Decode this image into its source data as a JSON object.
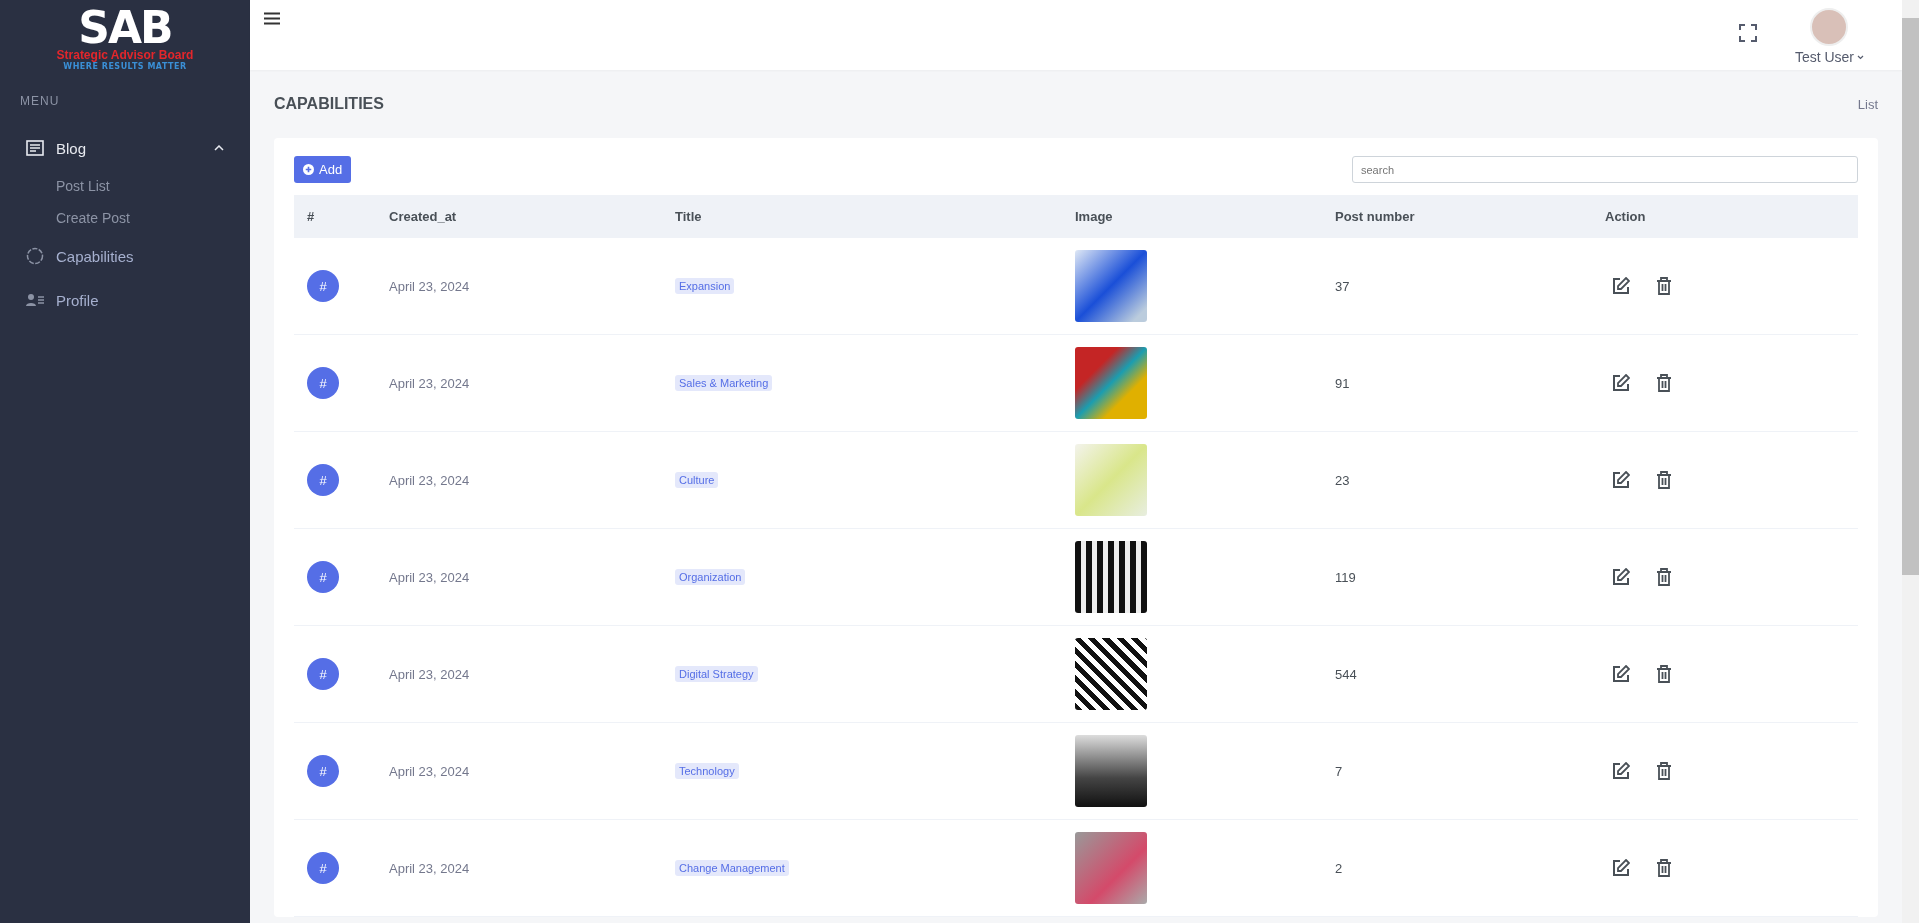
{
  "logo": {
    "mark": "SAB",
    "name": "Strategic Advisor Board",
    "tagline": "WHERE RESULTS MATTER"
  },
  "sidebar": {
    "heading": "MENU",
    "items": [
      {
        "label": "Blog",
        "kind": "blog",
        "expanded": true,
        "children": [
          {
            "label": "Post List"
          },
          {
            "label": "Create Post"
          }
        ]
      },
      {
        "label": "Capabilities",
        "kind": "capabilities"
      },
      {
        "label": "Profile",
        "kind": "profile"
      }
    ]
  },
  "header": {
    "user": "Test User"
  },
  "page": {
    "title": "CAPABILITIES",
    "breadcrumb": "List"
  },
  "toolbar": {
    "add_button": "Add",
    "search": {
      "placeholder": "search"
    }
  },
  "table": {
    "columns": [
      "#",
      "Created_at",
      "Title",
      "Image",
      "Post number",
      "Action"
    ],
    "rows": [
      {
        "badge": "#",
        "created_at": "April 23, 2024",
        "title": "Expansion",
        "post_number": "37"
      },
      {
        "badge": "#",
        "created_at": "April 23, 2024",
        "title": "Sales & Marketing",
        "post_number": "91"
      },
      {
        "badge": "#",
        "created_at": "April 23, 2024",
        "title": "Culture",
        "post_number": "23"
      },
      {
        "badge": "#",
        "created_at": "April 23, 2024",
        "title": "Organization",
        "post_number": "119"
      },
      {
        "badge": "#",
        "created_at": "April 23, 2024",
        "title": "Digital Strategy",
        "post_number": "544"
      },
      {
        "badge": "#",
        "created_at": "April 23, 2024",
        "title": "Technology",
        "post_number": "7"
      },
      {
        "badge": "#",
        "created_at": "April 23, 2024",
        "title": "Change Management",
        "post_number": "2"
      }
    ]
  }
}
